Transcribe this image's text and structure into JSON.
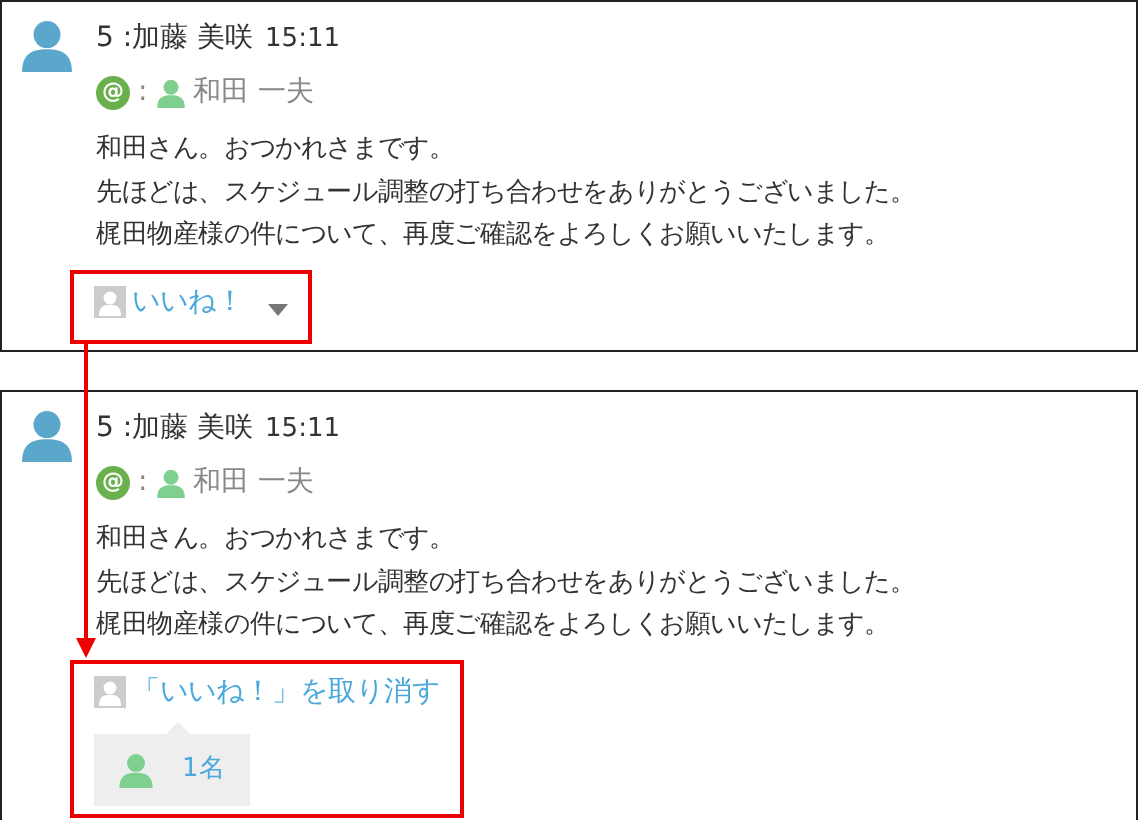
{
  "posts": [
    {
      "number": "5",
      "separator": ":",
      "author": "加藤 美咲",
      "time": "15:11",
      "mention_mark": "@",
      "mention_separator": ":",
      "mention_user": "和田 一夫",
      "body": [
        "和田さん。おつかれさまです。",
        "先ほどは、スケジュール調整の打ち合わせをありがとうございました。",
        "梶田物産様の件について、再度ご確認をよろしくお願いいたします。"
      ],
      "like": {
        "kind": "like",
        "label": "いいね！",
        "highlighted": true
      }
    },
    {
      "number": "5",
      "separator": ":",
      "author": "加藤 美咲",
      "time": "15:11",
      "mention_mark": "@",
      "mention_separator": ":",
      "mention_user": "和田 一夫",
      "body": [
        "和田さん。おつかれさまです。",
        "先ほどは、スケジュール調整の打ち合わせをありがとうございました。",
        "梶田物産様の件について、再度ご確認をよろしくお願いいたします。"
      ],
      "like": {
        "kind": "unlike",
        "label": "「いいね！」を取り消す",
        "highlighted": true,
        "count": "1名"
      }
    }
  ]
}
